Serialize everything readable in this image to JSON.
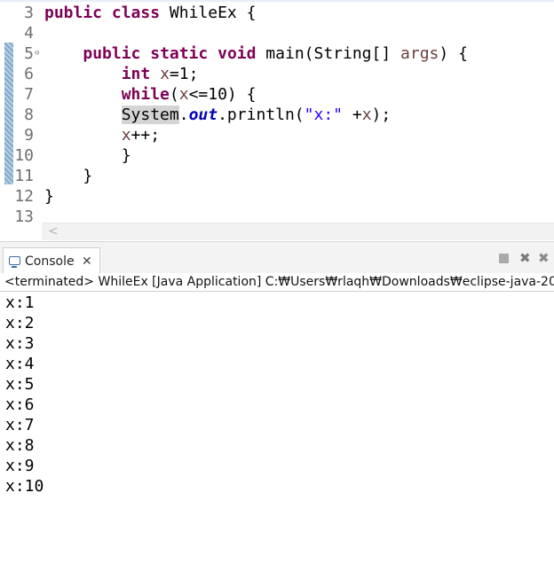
{
  "editor": {
    "lines": [
      {
        "num": "3",
        "tokens": [
          {
            "t": "public",
            "c": "kw"
          },
          {
            "t": " "
          },
          {
            "t": "class",
            "c": "kw"
          },
          {
            "t": " WhileEx {"
          }
        ]
      },
      {
        "num": "4",
        "tokens": []
      },
      {
        "num": "5",
        "fold": "⊖",
        "tokens": [
          {
            "t": "    "
          },
          {
            "t": "public",
            "c": "kw"
          },
          {
            "t": " "
          },
          {
            "t": "static",
            "c": "kw"
          },
          {
            "t": " "
          },
          {
            "t": "void",
            "c": "kw"
          },
          {
            "t": " main(String[] "
          },
          {
            "t": "args",
            "c": "var"
          },
          {
            "t": ") {"
          }
        ]
      },
      {
        "num": "6",
        "tokens": [
          {
            "t": "        "
          },
          {
            "t": "int",
            "c": "kw"
          },
          {
            "t": " "
          },
          {
            "t": "x",
            "c": "var"
          },
          {
            "t": "=1;"
          }
        ]
      },
      {
        "num": "7",
        "tokens": [
          {
            "t": "        "
          },
          {
            "t": "while",
            "c": "kw"
          },
          {
            "t": "("
          },
          {
            "t": "x",
            "c": "var"
          },
          {
            "t": "<=10) {"
          }
        ]
      },
      {
        "num": "8",
        "tokens": [
          {
            "t": "        "
          },
          {
            "t": "System",
            "c": "hl"
          },
          {
            "t": "."
          },
          {
            "t": "out",
            "c": "fld"
          },
          {
            "t": ".println("
          },
          {
            "t": "\"x:\"",
            "c": "str"
          },
          {
            "t": " +"
          },
          {
            "t": "x",
            "c": "var"
          },
          {
            "t": ");"
          }
        ]
      },
      {
        "num": "9",
        "tokens": [
          {
            "t": "        "
          },
          {
            "t": "x",
            "c": "var"
          },
          {
            "t": "++;"
          }
        ]
      },
      {
        "num": "10",
        "tokens": [
          {
            "t": "        }"
          }
        ]
      },
      {
        "num": "11",
        "tokens": [
          {
            "t": "    }"
          }
        ]
      },
      {
        "num": "12",
        "tokens": [
          {
            "t": "}"
          }
        ]
      },
      {
        "num": "13",
        "tokens": []
      }
    ],
    "scroll_left_glyph": "<"
  },
  "console": {
    "tab_label": "Console",
    "tab_close": "✕",
    "terminate_glyph": "",
    "remove_glyph": "✖",
    "remove_all_glyph": "✖",
    "status": "<terminated> WhileEx [Java Application] C:₩Users₩rlaqh₩Downloads₩eclipse-java-2022-0",
    "output": [
      "x:1",
      "x:2",
      "x:3",
      "x:4",
      "x:5",
      "x:6",
      "x:7",
      "x:8",
      "x:9",
      "x:10"
    ]
  }
}
